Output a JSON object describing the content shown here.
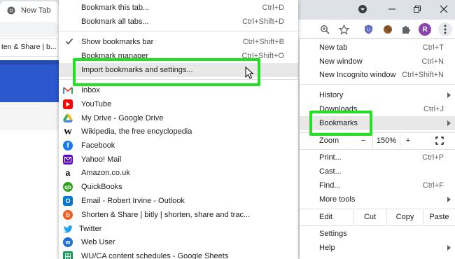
{
  "tab": {
    "title": "New Tab",
    "icon": "chrome-logo-icon"
  },
  "page": {
    "strip_text": "ten & Share | b..."
  },
  "toolbar": {
    "avatar_letter": "R"
  },
  "bookmarks_menu": {
    "actions": [
      {
        "label": "Bookmark this tab...",
        "shortcut": "Ctrl+D"
      },
      {
        "label": "Bookmark all tabs...",
        "shortcut": "Ctrl+Shift+D"
      }
    ],
    "show_bar": {
      "label": "Show bookmarks bar",
      "shortcut": "Ctrl+Shift+B",
      "checked": true
    },
    "manager": {
      "label": "Bookmark manager",
      "shortcut": "Ctrl+Shift+O"
    },
    "import": {
      "label": "Import bookmarks and settings..."
    },
    "items": [
      {
        "label": "Inbox",
        "icon": "gmail-icon"
      },
      {
        "label": "YouTube",
        "icon": "youtube-icon"
      },
      {
        "label": "My Drive - Google Drive",
        "icon": "google-drive-icon"
      },
      {
        "label": "Wikipedia, the free encyclopedia",
        "icon": "wikipedia-icon"
      },
      {
        "label": "Facebook",
        "icon": "facebook-icon"
      },
      {
        "label": "Yahoo! Mail",
        "icon": "yahoo-mail-icon"
      },
      {
        "label": "Amazon.co.uk",
        "icon": "amazon-icon"
      },
      {
        "label": "QuickBooks",
        "icon": "quickbooks-icon"
      },
      {
        "label": "Email - Robert Irvine - Outlook",
        "icon": "outlook-icon"
      },
      {
        "label": "Shorten & Share | bitly | shorten, share and trac...",
        "icon": "bitly-icon"
      },
      {
        "label": "Twitter",
        "icon": "twitter-icon"
      },
      {
        "label": "Web User",
        "icon": "webuser-icon"
      },
      {
        "label": "WU/CA content schedules - Google Sheets",
        "icon": "google-sheets-icon"
      }
    ]
  },
  "main_menu": {
    "new_tab": {
      "label": "New tab",
      "shortcut": "Ctrl+T"
    },
    "new_window": {
      "label": "New window",
      "shortcut": "Ctrl+N"
    },
    "incognito": {
      "label": "New Incognito window",
      "shortcut": "Ctrl+Shift+N"
    },
    "history": {
      "label": "History"
    },
    "downloads": {
      "label": "Downloads",
      "shortcut": "Ctrl+J"
    },
    "bookmarks": {
      "label": "Bookmarks"
    },
    "zoom": {
      "label": "Zoom",
      "minus": "−",
      "value": "150%",
      "plus": "+"
    },
    "print": {
      "label": "Print...",
      "shortcut": "Ctrl+P"
    },
    "cast": {
      "label": "Cast..."
    },
    "find": {
      "label": "Find...",
      "shortcut": "Ctrl+F"
    },
    "more_tools": {
      "label": "More tools"
    },
    "edit": {
      "label": "Edit",
      "cut": "Cut",
      "copy": "Copy",
      "paste": "Paste"
    },
    "settings": {
      "label": "Settings"
    },
    "help": {
      "label": "Help"
    }
  },
  "colors": {
    "highlight": "#22e022",
    "page_blue": "#2b58cc"
  }
}
